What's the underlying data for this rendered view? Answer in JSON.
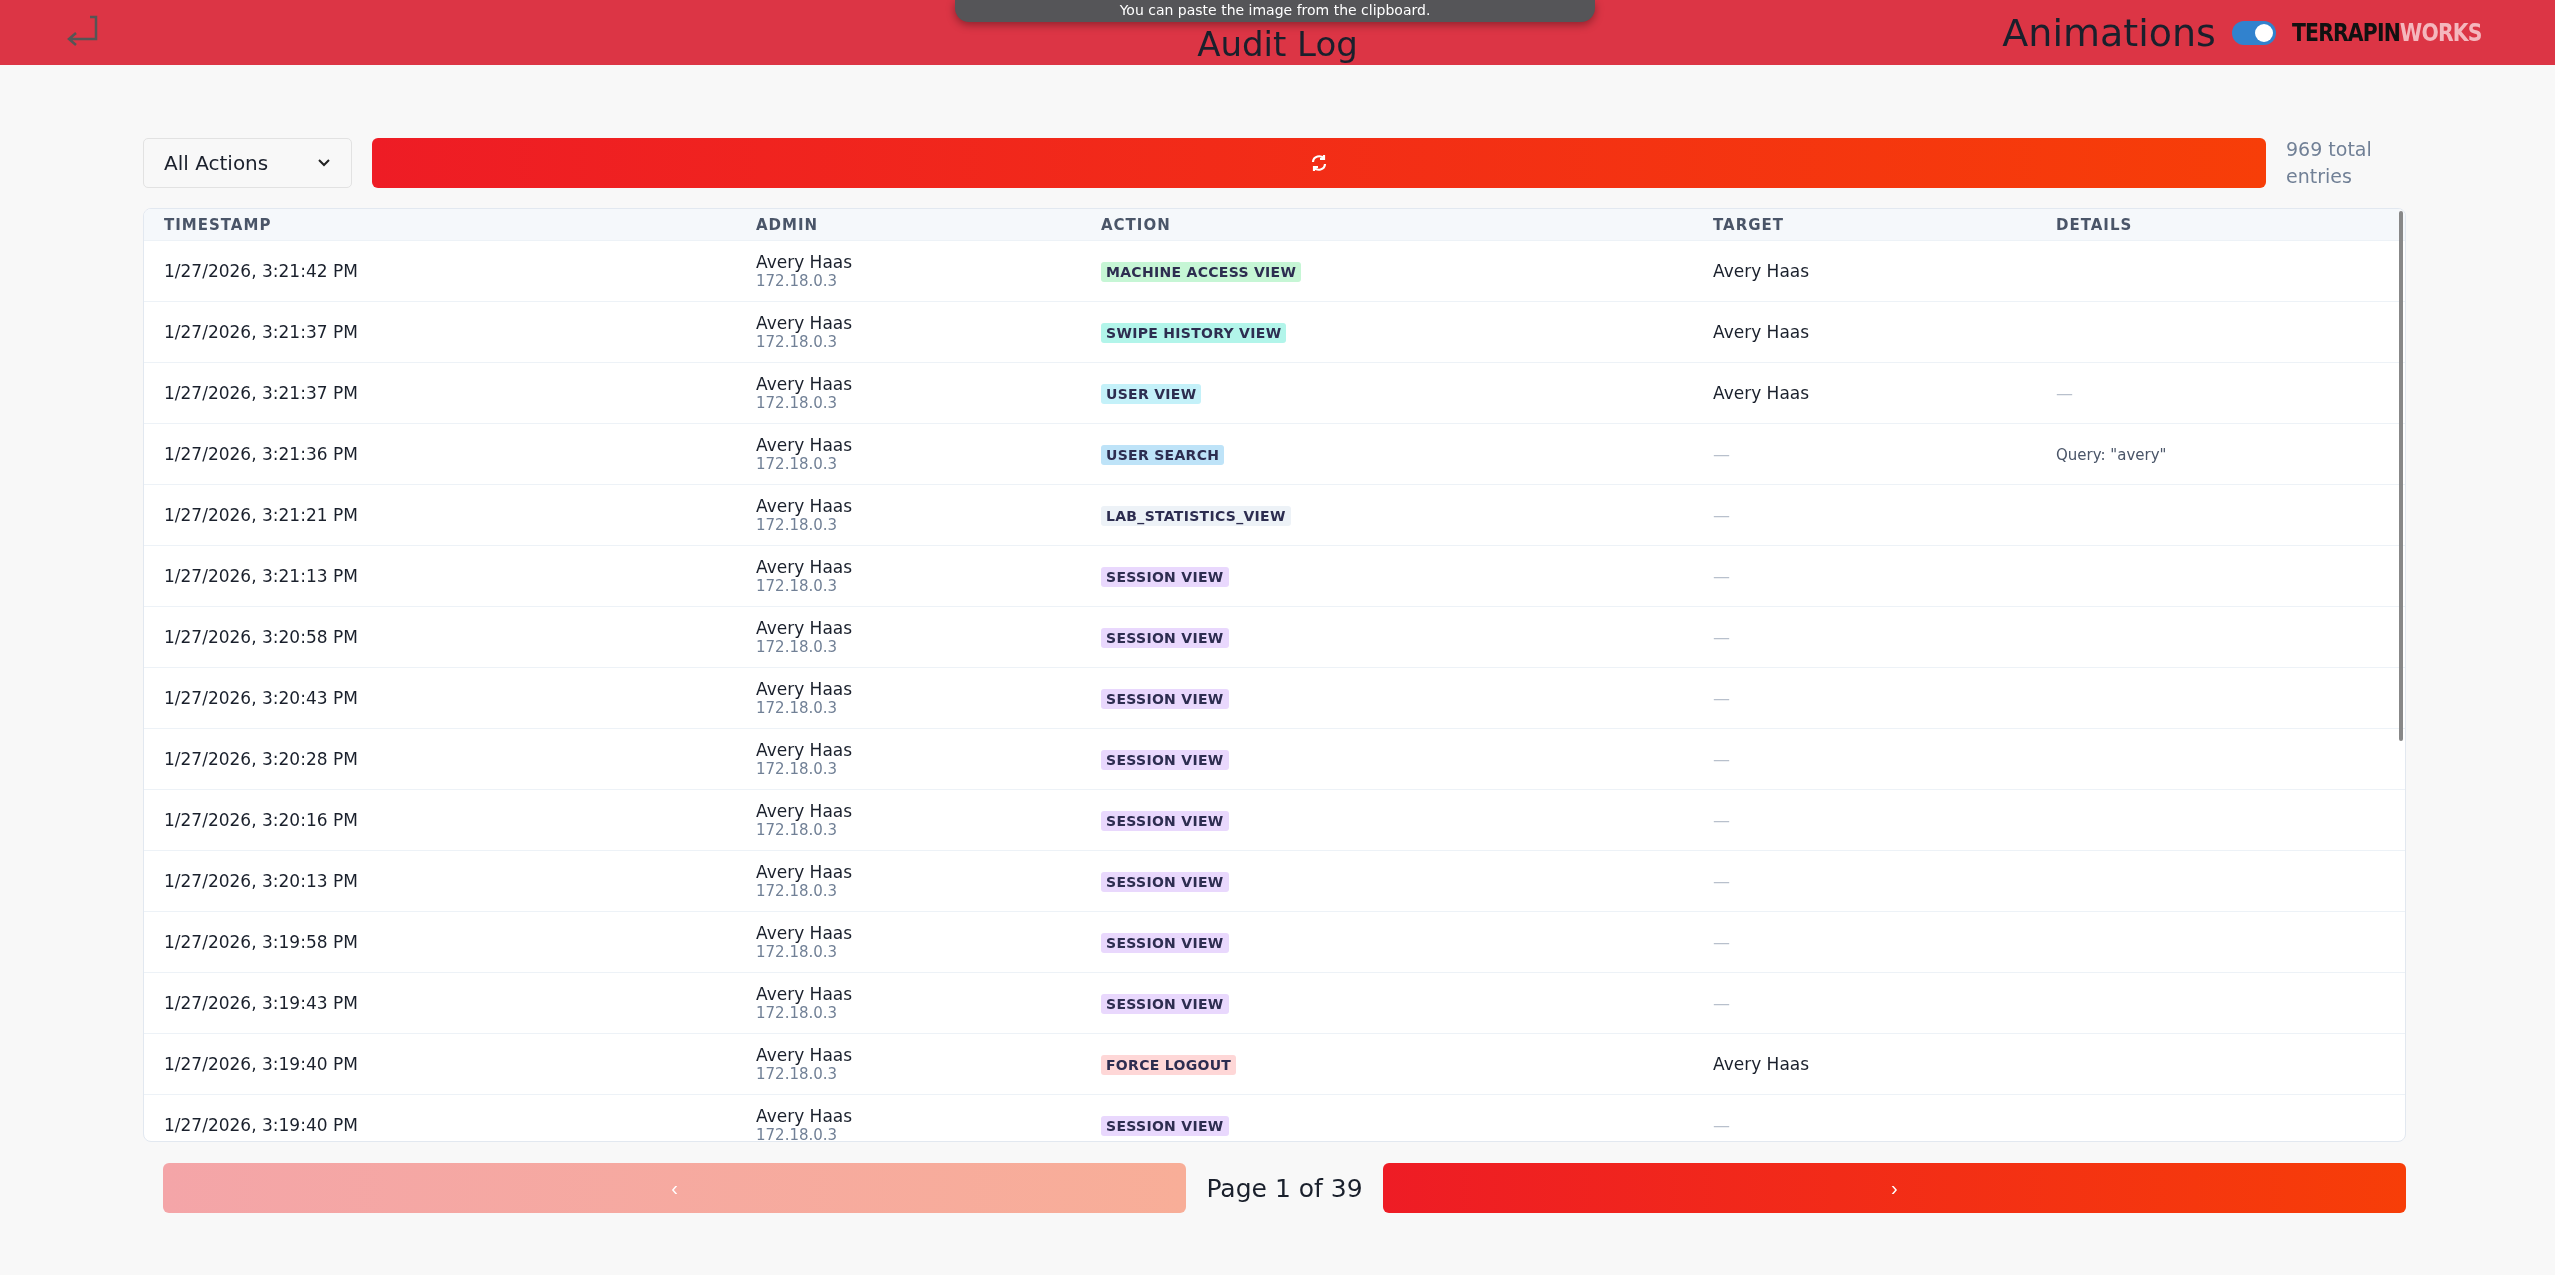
{
  "header": {
    "title": "Audit Log",
    "toast": "You can paste the image from the clipboard.",
    "animations": {
      "label": "Animations",
      "on": true
    },
    "logo": {
      "part_1": "TERRAPIN",
      "part_2": "WORKS"
    }
  },
  "toolbar": {
    "filter": "All Actions",
    "total": "969 total entries"
  },
  "table": {
    "columns": [
      "TIMESTAMP",
      "ADMIN",
      "ACTION",
      "TARGET",
      "DETAILS"
    ],
    "rows": [
      {
        "timestamp": "1/27/2026, 3:21:42 PM",
        "admin": "Avery Haas",
        "ip": "172.18.0.3",
        "action": "MACHINE ACCESS VIEW",
        "color": "#c6f6d5",
        "target": "Avery Haas",
        "details": ""
      },
      {
        "timestamp": "1/27/2026, 3:21:37 PM",
        "admin": "Avery Haas",
        "ip": "172.18.0.3",
        "action": "SWIPE HISTORY VIEW",
        "color": "#b2f5ea",
        "target": "Avery Haas",
        "details": ""
      },
      {
        "timestamp": "1/27/2026, 3:21:37 PM",
        "admin": "Avery Haas",
        "ip": "172.18.0.3",
        "action": "USER VIEW",
        "color": "#c4f1f9",
        "target": "Avery Haas",
        "details": "—"
      },
      {
        "timestamp": "1/27/2026, 3:21:36 PM",
        "admin": "Avery Haas",
        "ip": "172.18.0.3",
        "action": "USER SEARCH",
        "color": "#bee3f8",
        "target": "—",
        "details": "Query: \"avery\""
      },
      {
        "timestamp": "1/27/2026, 3:21:21 PM",
        "admin": "Avery Haas",
        "ip": "172.18.0.3",
        "action": "LAB_STATISTICS_VIEW",
        "color": "#edf2f7",
        "target": "—",
        "details": ""
      },
      {
        "timestamp": "1/27/2026, 3:21:13 PM",
        "admin": "Avery Haas",
        "ip": "172.18.0.3",
        "action": "SESSION VIEW",
        "color": "#e9d8fd",
        "target": "—",
        "details": ""
      },
      {
        "timestamp": "1/27/2026, 3:20:58 PM",
        "admin": "Avery Haas",
        "ip": "172.18.0.3",
        "action": "SESSION VIEW",
        "color": "#e9d8fd",
        "target": "—",
        "details": ""
      },
      {
        "timestamp": "1/27/2026, 3:20:43 PM",
        "admin": "Avery Haas",
        "ip": "172.18.0.3",
        "action": "SESSION VIEW",
        "color": "#e9d8fd",
        "target": "—",
        "details": ""
      },
      {
        "timestamp": "1/27/2026, 3:20:28 PM",
        "admin": "Avery Haas",
        "ip": "172.18.0.3",
        "action": "SESSION VIEW",
        "color": "#e9d8fd",
        "target": "—",
        "details": ""
      },
      {
        "timestamp": "1/27/2026, 3:20:16 PM",
        "admin": "Avery Haas",
        "ip": "172.18.0.3",
        "action": "SESSION VIEW",
        "color": "#e9d8fd",
        "target": "—",
        "details": ""
      },
      {
        "timestamp": "1/27/2026, 3:20:13 PM",
        "admin": "Avery Haas",
        "ip": "172.18.0.3",
        "action": "SESSION VIEW",
        "color": "#e9d8fd",
        "target": "—",
        "details": ""
      },
      {
        "timestamp": "1/27/2026, 3:19:58 PM",
        "admin": "Avery Haas",
        "ip": "172.18.0.3",
        "action": "SESSION VIEW",
        "color": "#e9d8fd",
        "target": "—",
        "details": ""
      },
      {
        "timestamp": "1/27/2026, 3:19:43 PM",
        "admin": "Avery Haas",
        "ip": "172.18.0.3",
        "action": "SESSION VIEW",
        "color": "#e9d8fd",
        "target": "—",
        "details": ""
      },
      {
        "timestamp": "1/27/2026, 3:19:40 PM",
        "admin": "Avery Haas",
        "ip": "172.18.0.3",
        "action": "FORCE LOGOUT",
        "color": "#fed7d7",
        "target": "Avery Haas",
        "details": ""
      },
      {
        "timestamp": "1/27/2026, 3:19:40 PM",
        "admin": "Avery Haas",
        "ip": "172.18.0.3",
        "action": "SESSION VIEW",
        "color": "#e9d8fd",
        "target": "—",
        "details": ""
      }
    ]
  },
  "pagination": {
    "prev": "‹",
    "page": "Page 1 of 39",
    "next": "›",
    "prev_disabled": true
  }
}
